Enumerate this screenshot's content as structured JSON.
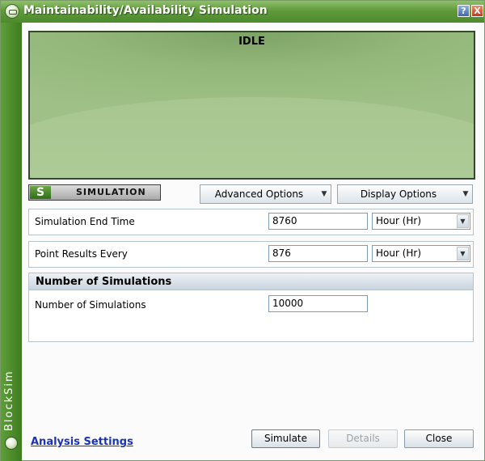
{
  "window": {
    "title": "Maintainability/Availability Simulation",
    "help_label": "?",
    "close_label": "X",
    "brand_text": "BlockSim"
  },
  "display": {
    "status": "IDLE"
  },
  "simulation_badge": {
    "letter": "S",
    "label": "Simulation"
  },
  "options": {
    "advanced_label": "Advanced Options",
    "display_label": "Display Options"
  },
  "params": {
    "end_time": {
      "label": "Simulation End Time",
      "value": "8760",
      "unit": "Hour (Hr)"
    },
    "point_results": {
      "label": "Point Results Every",
      "value": "876",
      "unit": "Hour (Hr)"
    }
  },
  "num_sims": {
    "header": "Number of Simulations",
    "label": "Number of Simulations",
    "value": "10000"
  },
  "footer": {
    "link_label": "Analysis Settings",
    "simulate_label": "Simulate",
    "details_label": "Details",
    "close_label": "Close"
  },
  "colors": {
    "title_bar": "#5f9b3c",
    "display_green": "#93b77a",
    "link_blue": "#1a33b8"
  }
}
